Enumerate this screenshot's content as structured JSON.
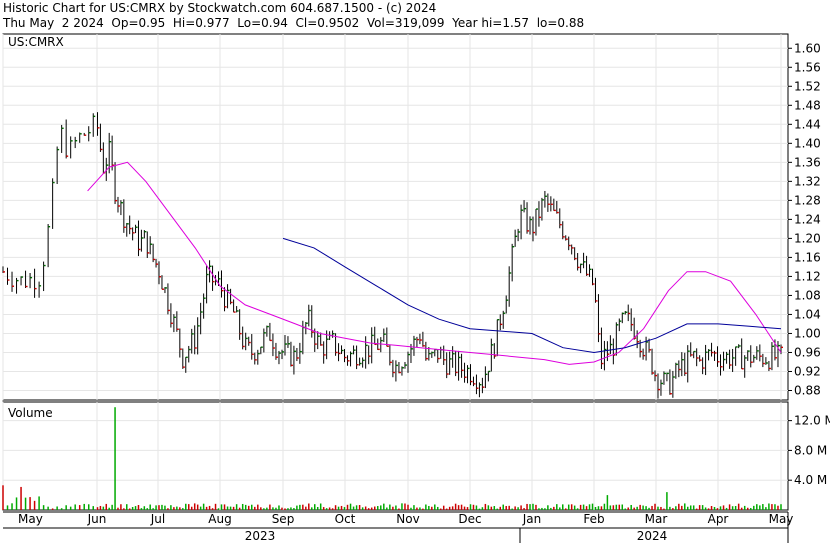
{
  "header": {
    "line1": "Historic Chart for US:CMRX by Stockwatch.com 604.687.1500 - (c) 2024",
    "line2": "Thu May  2 2024  Op=0.95  Hi=0.977  Lo=0.94  Cl=0.9502  Vol=319,099  Year hi=1.57  lo=0.88"
  },
  "colors": {
    "bar_up": "#006400",
    "bar_down": "#c80000",
    "bar_neutral": "#000000",
    "ma_short": "#dd00dd",
    "ma_long": "#000099",
    "volume_up": "#00aa00",
    "volume_down": "#cc0000",
    "grid": "#e6e6e6",
    "axis": "#000000"
  },
  "chart_data": [
    {
      "type": "line",
      "label": "US:CMRX",
      "ylim": [
        0.86,
        1.63
      ],
      "y_ticks": [
        "1.60",
        "1.56",
        "1.52",
        "1.48",
        "1.44",
        "1.40",
        "1.36",
        "1.32",
        "1.28",
        "1.24",
        "1.20",
        "1.16",
        "1.12",
        "1.08",
        "1.04",
        "1.00",
        "0.96",
        "0.92",
        "0.88"
      ],
      "x_months": [
        "May",
        "Jun",
        "Jul",
        "Aug",
        "Sep",
        "Oct",
        "Nov",
        "Dec",
        "Jan",
        "Feb",
        "Mar",
        "Apr",
        "May"
      ],
      "x_years": [
        "2023",
        "2024"
      ],
      "grid": true,
      "series": [
        {
          "kind": "close",
          "x_month_index": [
            0,
            0.2,
            0.4,
            0.5,
            0.6,
            0.7,
            0.8,
            1,
            1.1,
            1.2,
            1.3,
            1.4,
            1.5,
            1.6,
            1.7,
            1.8,
            1.9,
            2,
            2.2,
            2.4,
            2.6,
            2.8,
            3,
            3.1,
            3.2,
            3.3,
            3.4,
            3.5,
            3.6,
            3.7,
            3.8,
            3.9,
            4,
            4.2,
            4.4,
            4.6,
            4.8,
            5,
            5.2,
            5.4,
            5.6,
            5.8,
            6,
            6.1,
            6.2,
            6.3,
            6.4,
            6.5,
            6.6,
            6.8,
            7,
            7.2,
            7.4,
            7.6,
            7.8,
            8,
            8.2,
            8.4,
            8.6,
            8.8,
            9,
            9.1,
            9.2,
            9.3,
            9.4,
            9.5,
            9.6,
            9.7,
            9.8,
            9.9,
            10,
            10.1,
            10.2,
            10.3,
            10.4,
            10.5,
            10.6,
            10.7,
            10.8,
            10.9,
            11,
            11.2,
            11.4,
            11.6,
            11.8,
            12
          ],
          "y": [
            1.13,
            1.11,
            1.12,
            1.24,
            1.43,
            1.38,
            1.41,
            1.44,
            1.35,
            1.38,
            1.3,
            1.26,
            1.23,
            1.21,
            1.19,
            1.2,
            1.16,
            1.14,
            1.05,
            0.95,
            0.99,
            1.12,
            1.1,
            1.07,
            1.05,
            1.01,
            0.97,
            0.96,
            0.97,
            0.99,
            1.0,
            0.97,
            0.96,
            0.95,
            1.03,
            0.97,
            0.98,
            0.95,
            0.96,
            0.97,
            0.98,
            0.93,
            0.96,
            0.98,
            1.0,
            0.94,
            0.95,
            0.96,
            0.94,
            0.93,
            0.92,
            0.9,
            0.98,
            1.1,
            1.25,
            1.22,
            1.28,
            1.24,
            1.2,
            1.14,
            1.1,
            0.94,
            0.96,
            0.97,
            1.01,
            1.03,
            1.02,
            1.0,
            0.97,
            0.95,
            0.91,
            0.9,
            0.89,
            0.91,
            0.93,
            0.94,
            0.95,
            0.94,
            0.95,
            0.96,
            0.95,
            0.95,
            0.95,
            0.95,
            0.95,
            0.95
          ]
        },
        {
          "kind": "moving_average_short",
          "x_month_index": [
            0.9,
            1.2,
            1.5,
            1.8,
            2.2,
            2.6,
            3,
            3.4,
            3.8,
            4.2,
            4.6,
            5,
            5.4,
            5.8,
            6.2,
            6.6,
            7,
            7.4,
            7.8,
            8.2,
            8.6,
            9,
            9.4,
            9.8,
            10.2,
            10.5,
            10.8,
            11.2,
            11.6,
            12
          ],
          "y": [
            1.3,
            1.35,
            1.36,
            1.32,
            1.25,
            1.18,
            1.1,
            1.06,
            1.04,
            1.02,
            1.0,
            0.99,
            0.98,
            0.975,
            0.97,
            0.965,
            0.96,
            0.955,
            0.95,
            0.945,
            0.935,
            0.94,
            0.96,
            1.01,
            1.09,
            1.13,
            1.13,
            1.11,
            1.04,
            0.96
          ]
        },
        {
          "kind": "moving_average_long",
          "x_month_index": [
            4,
            4.5,
            5,
            5.5,
            6,
            6.5,
            7,
            7.5,
            8,
            8.5,
            9,
            9.5,
            10,
            10.5,
            11,
            11.5,
            12
          ],
          "y": [
            1.2,
            1.18,
            1.14,
            1.1,
            1.06,
            1.03,
            1.01,
            1.005,
            1.0,
            0.97,
            0.96,
            0.97,
            0.99,
            1.02,
            1.02,
            1.015,
            1.01
          ]
        }
      ]
    },
    {
      "type": "bar",
      "label": "Volume",
      "ylim": [
        0,
        14.5
      ],
      "y_ticks": [
        "12.0 M",
        "8.0 M",
        "4.0 M"
      ],
      "series": [
        {
          "name": "Volume",
          "spike_month_index": [
            1.3,
            9.2,
            10.2
          ],
          "spike_values": [
            13.8,
            2.0,
            2.4
          ],
          "baseline_value": 0.6
        }
      ]
    }
  ]
}
